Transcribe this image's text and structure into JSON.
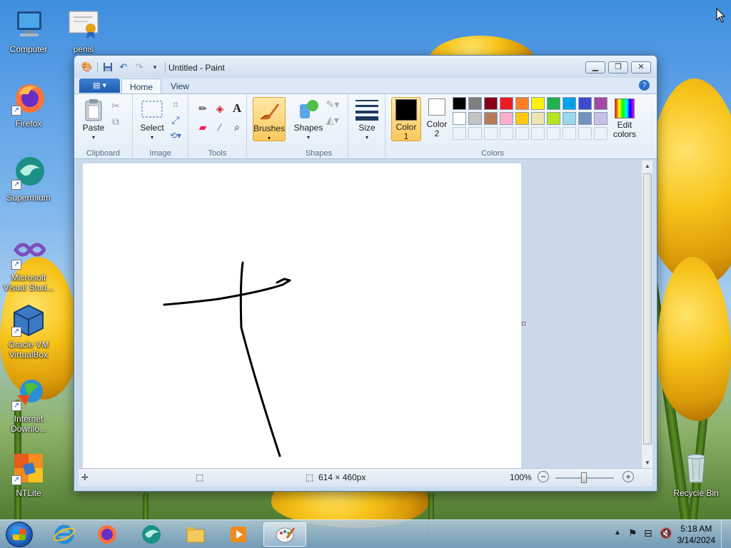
{
  "desktop": {
    "icons": [
      {
        "label": "Computer",
        "icon": "computer-icon"
      },
      {
        "label": "penis",
        "icon": "certificate-icon"
      },
      {
        "label": "Firefox",
        "icon": "firefox-icon"
      },
      {
        "label": "Supermium",
        "icon": "supermium-icon"
      },
      {
        "label": "Microsoft Visual Stud...",
        "icon": "visual-studio-icon"
      },
      {
        "label": "Oracle VM VirtualBox",
        "icon": "virtualbox-icon"
      },
      {
        "label": "Internet Downlo...",
        "icon": "internet-download-manager-icon"
      },
      {
        "label": "NTLite",
        "icon": "ntlite-icon"
      },
      {
        "label": "Recycle Bin",
        "icon": "recycle-bin-icon"
      }
    ]
  },
  "window": {
    "title": "Untitled - Paint",
    "file_tab": "",
    "tabs": [
      "Home",
      "View"
    ],
    "groups": {
      "clipboard": {
        "label": "Clipboard",
        "paste": "Paste"
      },
      "image": {
        "label": "Image",
        "select": "Select"
      },
      "tools": {
        "label": "Tools"
      },
      "brushes": {
        "label": "Brushes"
      },
      "shapes": {
        "label": "Shapes",
        "shapes_btn": "Shapes"
      },
      "size": {
        "label": "Size"
      },
      "colors": {
        "label": "Colors",
        "color1": "Color",
        "color1_num": "1",
        "color2": "Color",
        "color2_num": "2",
        "edit": "Edit",
        "edit2": "colors"
      }
    },
    "palette_row1": [
      "#000000",
      "#7f7f7f",
      "#880015",
      "#ed1c24",
      "#ff7f27",
      "#fff200",
      "#22b14c",
      "#00a2e8",
      "#3f48cc",
      "#a349a4"
    ],
    "palette_row2": [
      "#ffffff",
      "#c3c3c3",
      "#b97a57",
      "#ffaec9",
      "#ffc90e",
      "#efe4b0",
      "#b5e61d",
      "#99d9ea",
      "#7092be",
      "#c8bfe7"
    ],
    "status": {
      "dimensions": "614 × 460px",
      "zoom": "100%"
    }
  },
  "taskbar": {
    "time": "5:18 AM",
    "date": "3/14/2024"
  }
}
